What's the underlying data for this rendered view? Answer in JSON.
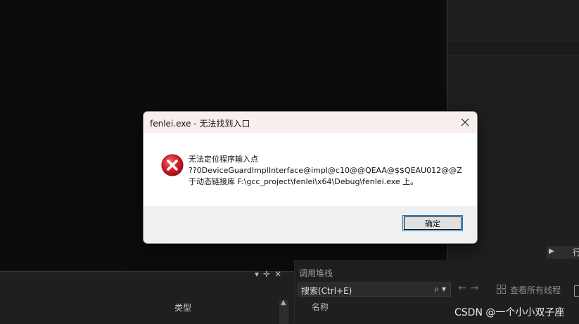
{
  "dialog": {
    "title": "fenlei.exe - 无法找到入口",
    "message_line1": "无法定位程序输入点",
    "message_line2": "??0DeviceGuardImplInterface@impl@c10@@QEAA@$$QEAU012@@Z",
    "message_line3": "于动态链接库 F:\\gcc_project\\fenlei\\x64\\Debug\\fenlei.exe 上。",
    "ok_label": "确定",
    "close_icon": "close-icon",
    "error_icon": "error-icon",
    "error_color": "#d21e2b"
  },
  "ide": {
    "column_type": "类型",
    "call_stack_title": "调用堆栈",
    "search_placeholder": "搜索(Ctrl+E)",
    "view_all_threads": "查看所有线程",
    "column_name": "名称",
    "right_edge_text": "行"
  },
  "watermark": "CSDN @一个小小双子座"
}
